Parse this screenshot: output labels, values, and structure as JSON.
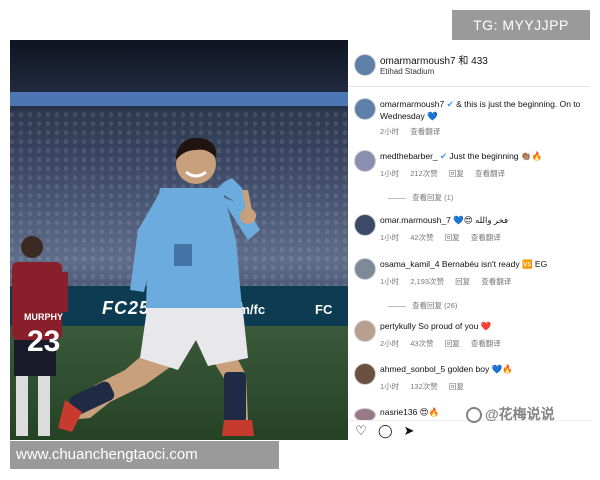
{
  "overlay": {
    "tg_label": "TG: MYYJJPP",
    "site_url": "www.chuanchengtaoci.com",
    "watermark": "@花梅说说"
  },
  "photo": {
    "ad_fc25": "FC25",
    "ad_site": "ts.com/fc",
    "ad_fc_right": "FC",
    "jersey_name": "MURPHY",
    "jersey_number": "23"
  },
  "post": {
    "username": "omarmarmoush7 和 433",
    "location": "Etihad Stadium"
  },
  "comments": [
    {
      "user": "omarmarmoush7",
      "text": "& this is just the beginning. On to Wednesday 💙",
      "meta": [
        "2小时",
        "查看翻译"
      ],
      "replies": ""
    },
    {
      "user": "medthebarber_",
      "text": "Just the beginning 👏🏽🔥",
      "meta": [
        "1小时",
        "212次赞",
        "回复",
        "查看翻译"
      ],
      "replies": "查看回复 (1)"
    },
    {
      "user": "omar.marmoush_7",
      "text": "💙😍 فخر والله",
      "meta": [
        "1小时",
        "42次赞",
        "回复",
        "查看翻译"
      ],
      "replies": ""
    },
    {
      "user": "osama_kamil_4",
      "text": "Bernabéu isn't ready 🆚 EG",
      "meta": [
        "1小时",
        "2,193次赞",
        "回复",
        "查看翻译"
      ],
      "replies": "查看回复 (26)"
    },
    {
      "user": "pertykully",
      "text": "So proud of you ❤️",
      "meta": [
        "2小时",
        "43次赞",
        "回复",
        "查看翻译"
      ],
      "replies": ""
    },
    {
      "user": "ahmed_sonbol_5",
      "text": "golden boy 💙🔥",
      "meta": [
        "1小时",
        "132次赞",
        "回复"
      ],
      "replies": ""
    },
    {
      "user": "nasrie136",
      "text": "😍🔥",
      "meta": [],
      "replies": ""
    }
  ],
  "actions": {
    "like_icon": "heart-outline-icon",
    "comment_icon": "comment-bubble-icon",
    "share_icon": "send-paper-plane-icon"
  },
  "colors": {
    "city_blue": "#6cabdd",
    "overlay_gray": "#9a9a9a",
    "verified_blue": "#3897f0"
  }
}
